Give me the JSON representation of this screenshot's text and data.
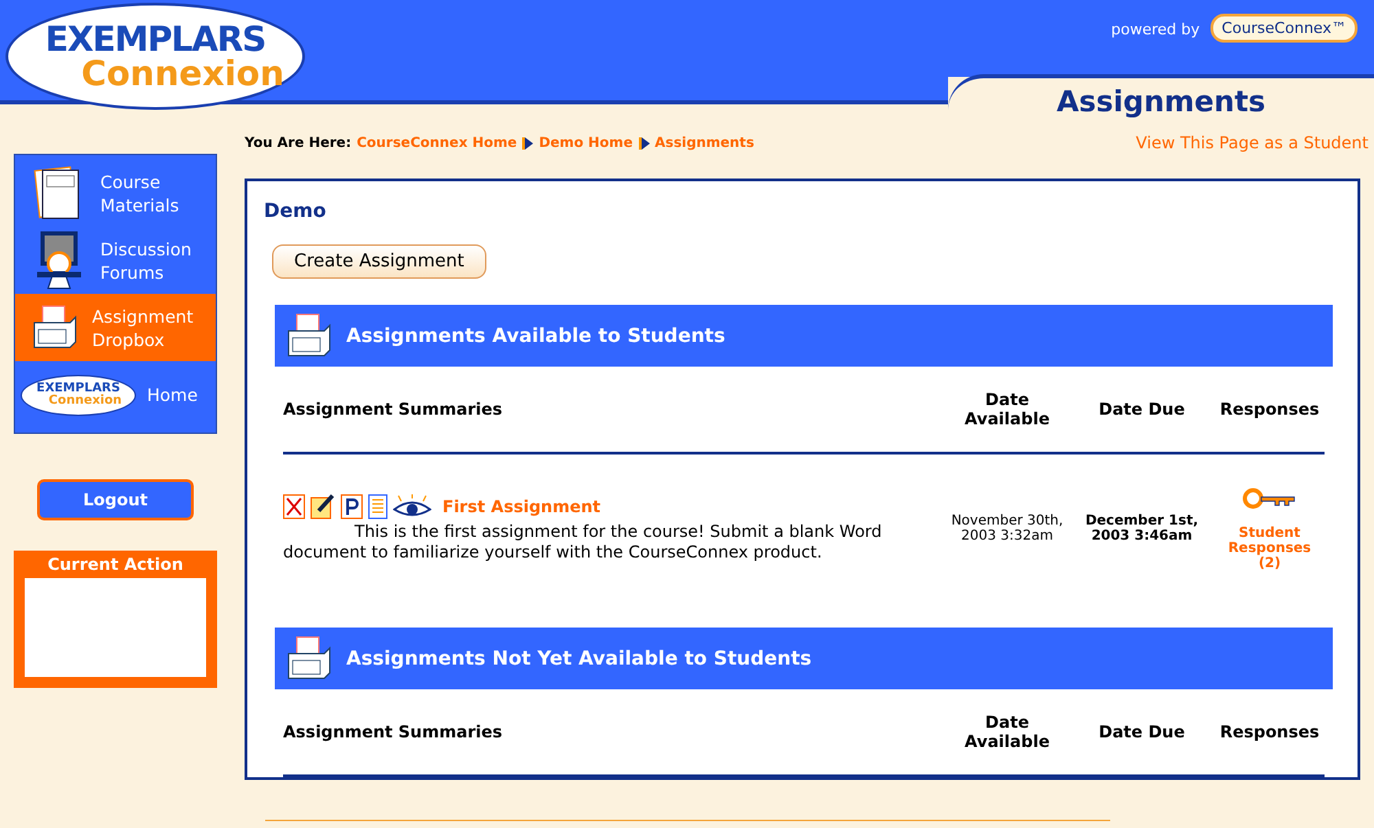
{
  "header": {
    "logo": {
      "line1": "EXEMPLARS",
      "line2": "Connexion"
    },
    "powered_by": "powered by",
    "powered_brand": "CourseConnex™",
    "page_title": "Assignments"
  },
  "sidebar": {
    "items": [
      {
        "kind": "materials",
        "label": "Course Materials",
        "selected": false
      },
      {
        "kind": "forums",
        "label": "Discussion Forums",
        "selected": false
      },
      {
        "kind": "dropbox",
        "label": "Assignment Dropbox",
        "selected": true
      },
      {
        "kind": "home",
        "label": "Home",
        "selected": false,
        "logo_line1": "EXEMPLARS",
        "logo_line2": "Connexion"
      }
    ],
    "logout": "Logout",
    "current_action": {
      "title": "Current Action"
    }
  },
  "breadcrumb": {
    "prefix": "You Are Here:",
    "items": [
      "CourseConnex Home",
      "Demo Home",
      "Assignments"
    ]
  },
  "view_as_student": "View This Page as a Student",
  "panel": {
    "title": "Demo",
    "create_button": "Create Assignment",
    "sections": [
      {
        "title": "Assignments Available to Students",
        "columns": [
          "Assignment Summaries",
          "Date Available",
          "Date Due",
          "Responses"
        ],
        "rows": [
          {
            "title": "First Assignment",
            "description": "This is the first assignment for the course! Submit a blank Word document to familiarize yourself with the CourseConnex product.",
            "date_available": "November 30th, 2003 3:32am",
            "date_due": "December 1st, 2003 3:46am",
            "responses": "Student Responses (2)"
          }
        ]
      },
      {
        "title": "Assignments Not Yet Available to Students",
        "columns": [
          "Assignment Summaries",
          "Date Available",
          "Date Due",
          "Responses"
        ]
      }
    ]
  }
}
